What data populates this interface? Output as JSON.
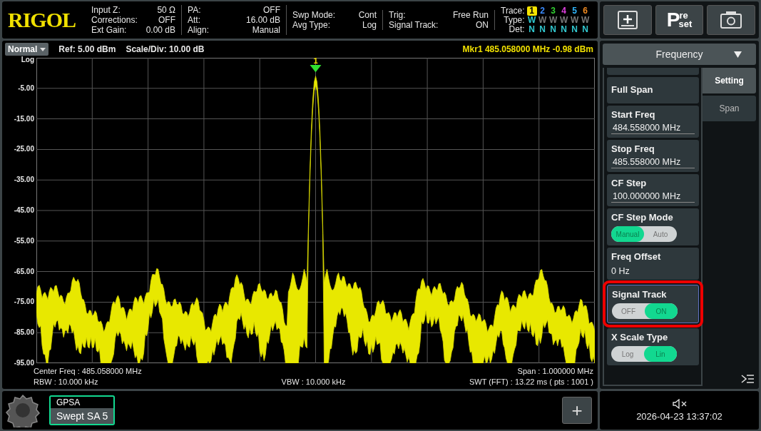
{
  "logo": "RIGOL",
  "status_groups": [
    [
      {
        "label": "Input Z:",
        "value": "50 Ω"
      },
      {
        "label": "Corrections:",
        "value": "OFF"
      },
      {
        "label": "Ext Gain:",
        "value": "0.00 dB"
      }
    ],
    [
      {
        "label": "PA:",
        "value": "OFF"
      },
      {
        "label": "Att:",
        "value": "16.00 dB"
      },
      {
        "label": "Align:",
        "value": "Manual"
      }
    ],
    [
      {
        "label": "Swp Mode:",
        "value": "Cont"
      },
      {
        "label": "Avg Type:",
        "value": "Log"
      }
    ],
    [
      {
        "label": "Trig:",
        "value": "Free Run"
      },
      {
        "label": "Signal Track:",
        "value": "ON"
      }
    ]
  ],
  "trace_table": {
    "trace_label": "Trace:",
    "type_label": "Type:",
    "det_label": "Det:",
    "traces": [
      {
        "number": "1",
        "color": "#f5e400",
        "selected": true,
        "type": "W",
        "type_active": true,
        "det": "N"
      },
      {
        "number": "2",
        "color": "#3b8cff",
        "selected": false,
        "type": "W",
        "type_active": false,
        "det": "N"
      },
      {
        "number": "3",
        "color": "#32d232",
        "selected": false,
        "type": "W",
        "type_active": false,
        "det": "N"
      },
      {
        "number": "4",
        "color": "#e040e0",
        "selected": false,
        "type": "W",
        "type_active": false,
        "det": "N"
      },
      {
        "number": "5",
        "color": "#30b8ff",
        "selected": false,
        "type": "W",
        "type_active": false,
        "det": "N"
      },
      {
        "number": "6",
        "color": "#f08a20",
        "selected": false,
        "type": "W",
        "type_active": false,
        "det": "N"
      }
    ]
  },
  "info_bar": {
    "mode": "Normal",
    "ref": "Ref: 5.00 dBm",
    "scale": "Scale/Div: 10.00 dB",
    "marker_readout": "Mkr1 485.058000 MHz -0.98 dBm"
  },
  "plot": {
    "scale_label": "Log",
    "y_ticks": [
      "-5.00",
      "-15.00",
      "-25.00",
      "-35.00",
      "-45.00",
      "-55.00",
      "-65.00",
      "-75.00",
      "-85.00",
      "-95.00"
    ],
    "marker_label": "1"
  },
  "footer": {
    "center_freq": "Center Freq : 485.058000 MHz",
    "span": "Span : 1.000000 MHz",
    "rbw": "RBW : 10.000 kHz",
    "vbw": "VBW : 10.000 kHz",
    "swt": "SWT (FFT) : 13.22 ms ( pts : 1001 )"
  },
  "app_tab": {
    "group": "GPSA",
    "name": "Swept SA 5"
  },
  "add_button": "+",
  "preset_button": {
    "initial": "P",
    "top": "re",
    "bottom": "set"
  },
  "menu": {
    "title": "Frequency",
    "items": [
      {
        "kind": "button",
        "label": "Full Span"
      },
      {
        "kind": "input",
        "label": "Start Freq",
        "value": "484.558000 MHz"
      },
      {
        "kind": "input",
        "label": "Stop Freq",
        "value": "485.558000 MHz"
      },
      {
        "kind": "input",
        "label": "CF Step",
        "value": "100.000000 MHz"
      },
      {
        "kind": "toggle",
        "label": "CF Step Mode",
        "options": [
          {
            "label": "Manual",
            "selected": true
          },
          {
            "label": "Auto",
            "selected": false
          }
        ]
      },
      {
        "kind": "readout",
        "label": "Freq Offset",
        "value": "0 Hz"
      },
      {
        "kind": "toggle",
        "label": "Signal Track",
        "highlighted": true,
        "options": [
          {
            "label": "OFF",
            "selected": false
          },
          {
            "label": "ON",
            "selected": true
          }
        ]
      },
      {
        "kind": "toggle",
        "label": "X Scale Type",
        "options": [
          {
            "label": "Log",
            "selected": false
          },
          {
            "label": "Lin",
            "selected": true
          }
        ]
      }
    ],
    "tabs": [
      {
        "label": "Setting",
        "selected": true
      },
      {
        "label": "Span",
        "selected": false
      }
    ]
  },
  "datetime": "2026-04-23 13:37:02"
}
